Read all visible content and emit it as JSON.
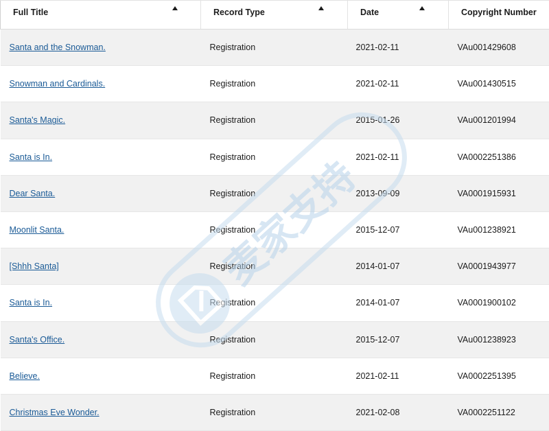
{
  "table": {
    "columns": [
      {
        "label": "Full Title",
        "sortable": true
      },
      {
        "label": "Record Type",
        "sortable": true
      },
      {
        "label": "Date",
        "sortable": true
      },
      {
        "label": "Copyright Number",
        "sortable": false
      }
    ],
    "rows": [
      {
        "title": "Santa and the Snowman.",
        "type": "Registration",
        "date": "2021-02-11",
        "number": "VAu001429608"
      },
      {
        "title": "Snowman and Cardinals.",
        "type": "Registration",
        "date": "2021-02-11",
        "number": "VAu001430515"
      },
      {
        "title": "Santa's Magic.",
        "type": "Registration",
        "date": "2015-01-26",
        "number": "VAu001201994"
      },
      {
        "title": "Santa is In.",
        "type": "Registration",
        "date": "2021-02-11",
        "number": "VA0002251386"
      },
      {
        "title": "Dear Santa.",
        "type": "Registration",
        "date": "2013-09-09",
        "number": "VA0001915931"
      },
      {
        "title": "Moonlit Santa.",
        "type": "Registration",
        "date": "2015-12-07",
        "number": "VAu001238921"
      },
      {
        "title": "[Shhh Santa]",
        "type": "Registration",
        "date": "2014-01-07",
        "number": "VA0001943977"
      },
      {
        "title": "Santa is In.",
        "type": "Registration",
        "date": "2014-01-07",
        "number": "VA0001900102"
      },
      {
        "title": "Santa's Office.",
        "type": "Registration",
        "date": "2015-12-07",
        "number": "VAu001238923"
      },
      {
        "title": "Believe.",
        "type": "Registration",
        "date": "2021-02-11",
        "number": "VA0002251395"
      },
      {
        "title": "Christmas Eve Wonder.",
        "type": "Registration",
        "date": "2021-02-08",
        "number": "VA0002251122"
      }
    ]
  },
  "watermark": {
    "text": "麦家支持",
    "icon": "shield-logo-icon"
  },
  "colors": {
    "link": "#1a5a96",
    "row_stripe": "#f1f1f1",
    "text": "#1b1b1b",
    "watermark": "#b7d3ea"
  }
}
